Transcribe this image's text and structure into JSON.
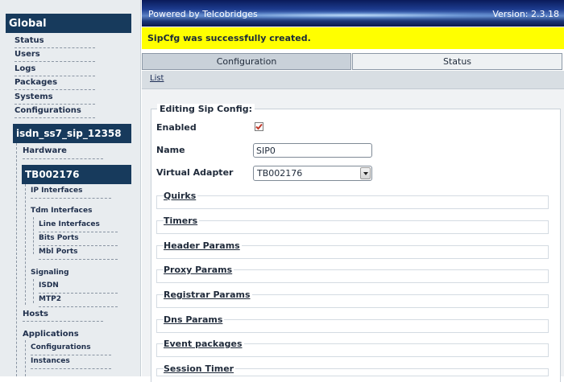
{
  "sidebar": {
    "global_title": "Global",
    "global_items": [
      "Status",
      "Users",
      "Logs",
      "Packages",
      "Systems",
      "Configurations"
    ],
    "config_title": "isdn_ss7_sip_12358",
    "hardware_label": "Hardware",
    "host_title": "TB002176",
    "ip_interfaces": "IP Interfaces",
    "tdm_interfaces": "Tdm Interfaces",
    "tdm_children": [
      "Line Interfaces",
      "Bits Ports",
      "Mbl Ports"
    ],
    "signaling": "Signaling",
    "signaling_children": [
      "ISDN",
      "MTP2"
    ],
    "hosts": "Hosts",
    "applications": "Applications",
    "applications_children": [
      "Configurations",
      "Instances"
    ]
  },
  "banner": {
    "powered_by": "Powered by Telcobridges",
    "version": "Version: 2.3.18"
  },
  "success_message": "SipCfg was successfully created.",
  "tabs": {
    "configuration": "Configuration",
    "status": "Status"
  },
  "subbar": {
    "list_link": "List"
  },
  "form": {
    "legend": "Editing Sip Config:",
    "enabled_label": "Enabled",
    "enabled_checked": true,
    "name_label": "Name",
    "name_value": "SIP0",
    "adapter_label": "Virtual Adapter",
    "adapter_value": "TB002176",
    "sections": [
      "Quirks",
      "Timers",
      "Header Params",
      "Proxy Params",
      "Registrar Params",
      "Dns Params",
      "Event packages",
      "Session Timer"
    ]
  },
  "colors": {
    "sidebar_header": "#173a5c",
    "success_bar": "#ffff00",
    "checkbox_mark": "#c0392b"
  }
}
